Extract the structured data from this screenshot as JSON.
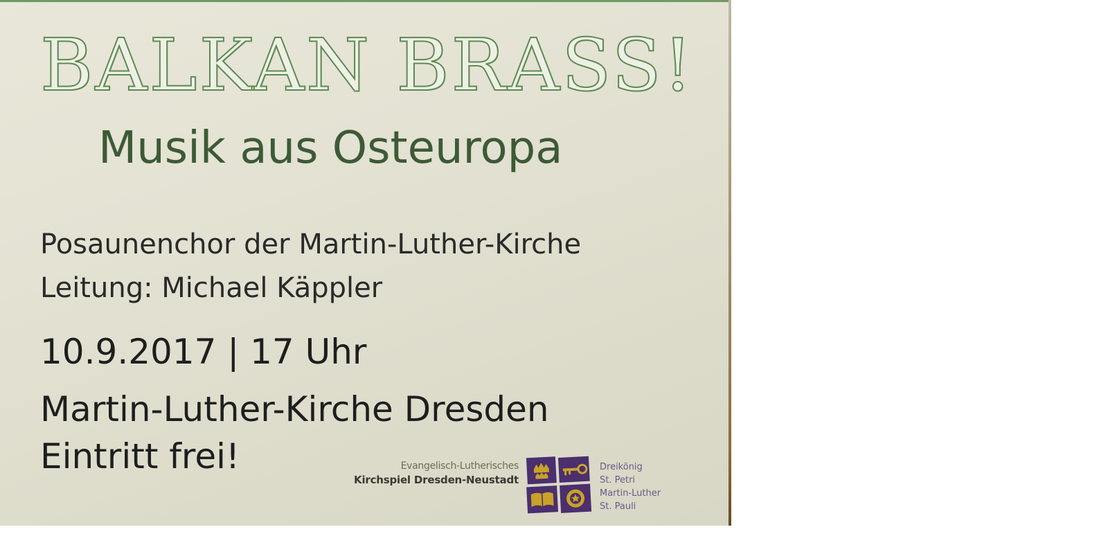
{
  "poster": {
    "title": "BALKAN BRASS!",
    "subtitle": "Musik aus Osteuropa",
    "choir": "Posaunenchor der Martin-Luther-Kirche",
    "leader": "Leitung: Michael Käppler",
    "datetime": "10.9.2017 | 17 Uhr",
    "venue": "Martin-Luther-Kirche Dresden",
    "entry": "Eintritt frei!"
  },
  "organization": {
    "line1": "Evangelisch-Lutherisches",
    "line2": "Kirchspiel Dresden-Neustadt",
    "logo_icon": "parish-crest-icon",
    "parishes": [
      "Dreikönig",
      "St. Petri",
      "Martin-Luther",
      "St. Pauli"
    ]
  },
  "colors": {
    "title_green": "#5d8a52",
    "subtitle_green": "#3d5a36",
    "logo_purple": "#4b2f6e",
    "logo_gold": "#c9a227",
    "paper": "#e4e2d3"
  }
}
